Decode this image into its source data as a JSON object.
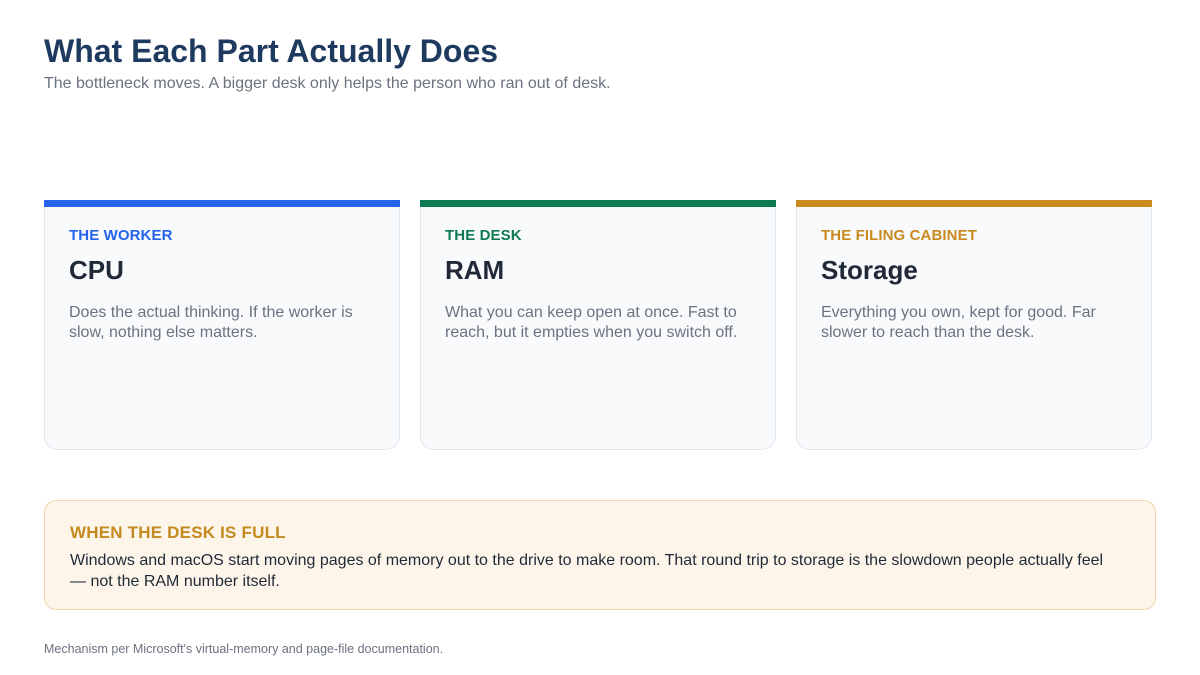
{
  "header": {
    "title": "What Each Part Actually Does",
    "subtitle": "The bottleneck moves. A bigger desk only helps the person who ran out of desk."
  },
  "cards": [
    {
      "eyebrow": "THE WORKER",
      "heading": "CPU",
      "body": "Does the actual thinking. If the worker is slow, nothing else matters.",
      "accent": "#2563eb"
    },
    {
      "eyebrow": "THE DESK",
      "heading": "RAM",
      "body": "What you can keep open at once. Fast to reach, but it empties when you switch off.",
      "accent": "#0f7a4f"
    },
    {
      "eyebrow": "THE FILING CABINET",
      "heading": "Storage",
      "body": "Everything you own, kept for good. Far slower to reach than the desk.",
      "accent": "#c98a1e"
    }
  ],
  "callout": {
    "title": "WHEN THE DESK IS FULL",
    "body": "Windows and macOS start moving pages of memory out to the drive to make room. That round trip to storage is the slowdown people actually feel — not the RAM number itself.",
    "accent": "#c48a1f"
  },
  "footer": {
    "note": "Mechanism per Microsoft's virtual-memory and page-file documentation."
  }
}
